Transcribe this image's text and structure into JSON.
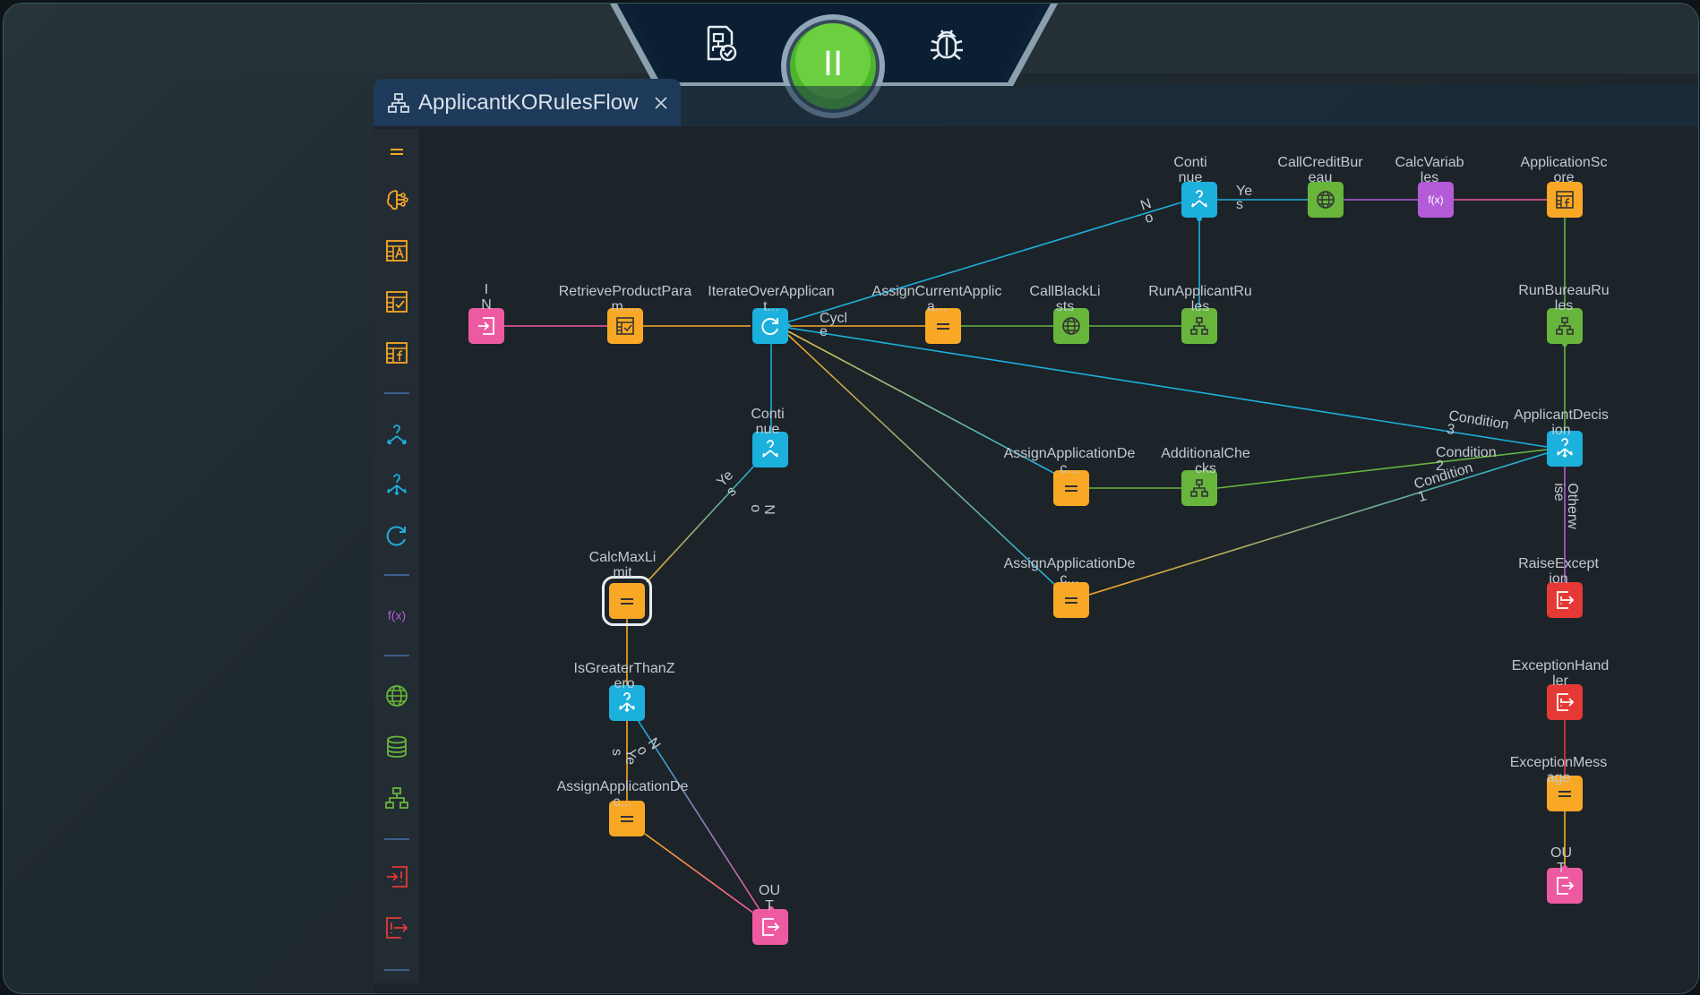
{
  "tab": {
    "title": "ApplicantKORulesFlow"
  },
  "toolbar": {
    "pause_label": "II"
  },
  "nodes": {
    "in": "I\nN",
    "retrieve": "RetrieveProductPara\nm....",
    "iterate": "IterateOverApplican\nt...",
    "assign_current": "AssignCurrentApplic\na...",
    "call_black": "CallBlackLi\nsts",
    "run_applicant": "RunApplicantRu\nles",
    "continue_top": "Conti\nnue",
    "call_credit": "CallCreditBur\neau",
    "calc_vars": "CalcVariab\nles",
    "app_score": "ApplicationSc\nore",
    "run_bureau": "RunBureauRu\nles",
    "app_decision": "ApplicantDecis\nion",
    "continue_mid": "Conti\nnue",
    "assign_dec1": "AssignApplicationDe\nc...",
    "additional": "AdditionalChe\ncks",
    "assign_dec2": "AssignApplicationDe\nc...",
    "calc_max": "CalcMaxLi\nmit",
    "is_greater": "IsGreaterThanZ\nero",
    "assign_dec3": "AssignApplicationDe\nc...",
    "out_bottom": "OU\nT",
    "raise_exc": "RaiseExcept\nion",
    "exc_handler": "ExceptionHand\nler",
    "exc_message": "ExceptionMess\nage",
    "out_right": "OU\nT"
  },
  "edge_labels": {
    "cycle": "Cycl\ne",
    "no_top": "N\no",
    "yes_top": "Ye\ns",
    "cond3": "Condition\n3",
    "cond2": "Condition\n2",
    "cond1": "Condition\n1",
    "otherwise": "Otherw\nise",
    "yes_mid": "Ye\ns",
    "no_mid": "N\no",
    "no_low": "N\no",
    "yes_low": "Ye\ns"
  },
  "colors": {
    "orange": "#f9a825",
    "cyan": "#1cb0dc",
    "green": "#67b53b",
    "pink": "#ee5aa1",
    "purple": "#b45cd8",
    "red": "#e53935",
    "pause": "#5ec43a"
  },
  "palette": {
    "items": [
      "assignment-icon",
      "brain-rules-icon",
      "decision-table-icon",
      "checklist-icon",
      "scorecard-icon",
      "decision-icon",
      "multi-decision-icon",
      "loop-icon",
      "function-icon",
      "web-service-icon",
      "database-icon",
      "subflow-icon",
      "raise-exception-icon",
      "exception-handler-icon"
    ]
  }
}
